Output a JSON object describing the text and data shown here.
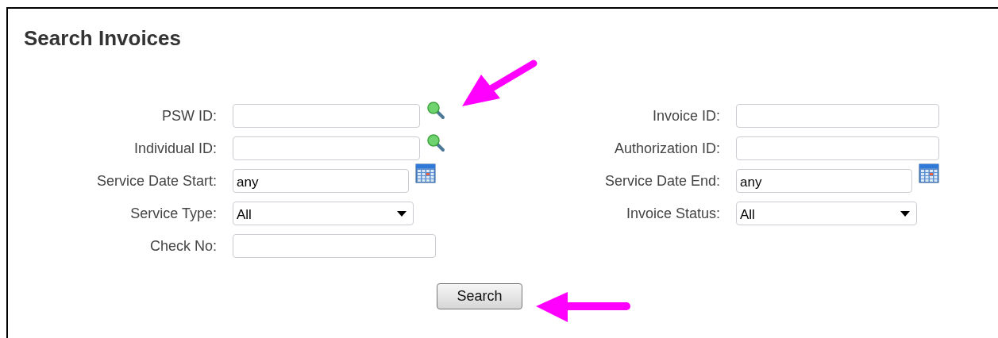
{
  "title": "Search Invoices",
  "left_fields": [
    {
      "label": "PSW ID:",
      "kind": "lookup"
    },
    {
      "label": "Individual ID:",
      "kind": "lookup"
    },
    {
      "label": "Service Date Start:",
      "kind": "date",
      "value": "any"
    },
    {
      "label": "Service Type:",
      "kind": "select",
      "value": "All"
    },
    {
      "label": "Check No:",
      "kind": "text"
    }
  ],
  "right_fields": [
    {
      "label": "Invoice ID:",
      "kind": "text"
    },
    {
      "label": "Authorization ID:",
      "kind": "text"
    },
    {
      "label": "Service Date End:",
      "kind": "date",
      "value": "any"
    },
    {
      "label": "Invoice Status:",
      "kind": "select",
      "value": "All"
    }
  ],
  "search_button": "Search"
}
